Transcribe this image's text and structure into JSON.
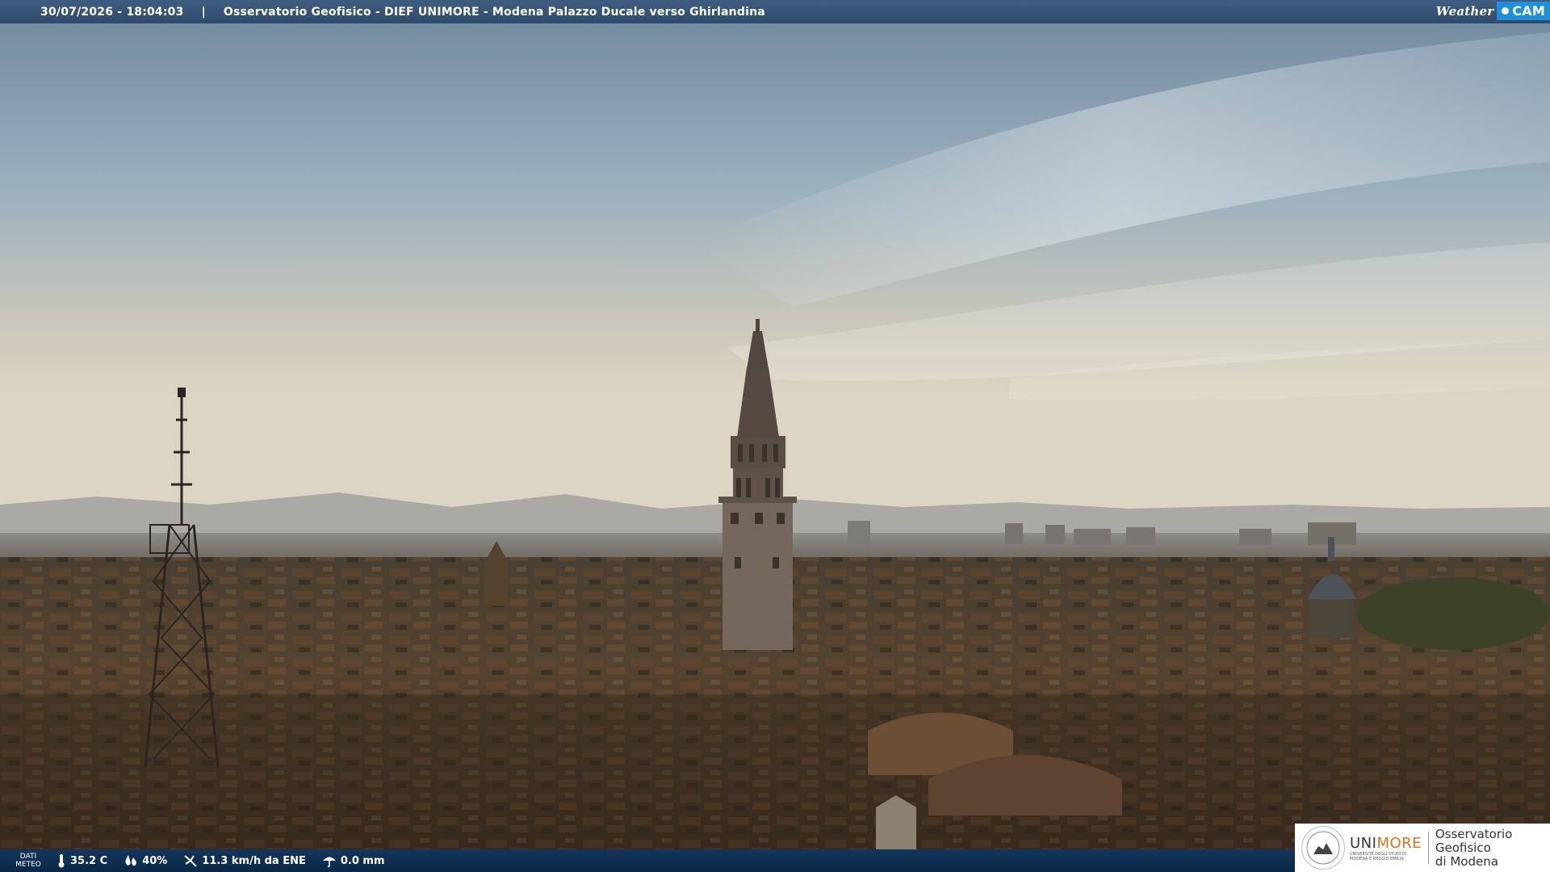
{
  "header": {
    "timestamp": "30/07/2026 - 18:04:03",
    "separator": "|",
    "title": "Osservatorio Geofisico - DIEF UNIMORE - Modena Palazzo Ducale verso Ghirlandina"
  },
  "brand": {
    "weather": "Weather",
    "cam": "CAM"
  },
  "meteo": {
    "label_line1": "DATI",
    "label_line2": "METEO",
    "temperature": "35.2 C",
    "humidity": "40%",
    "wind": "11.3 km/h da ENE",
    "rain": "0.0 mm"
  },
  "logo": {
    "uni_prefix": "UNI",
    "uni_suffix": "MORE",
    "uni_subtitle_line1": "UNIVERSITÀ DEGLI STUDI DI",
    "uni_subtitle_line2": "MODENA E REGGIO EMILIA",
    "observatory_line1": "Osservatorio Geofisico",
    "observatory_line2": "di Modena"
  },
  "colors": {
    "sky_top": "#7d98ad",
    "sky_horizon": "#d9d3c4",
    "city": "#3a2f22",
    "bar": "#2f4b6c",
    "accent": "#e07020"
  }
}
